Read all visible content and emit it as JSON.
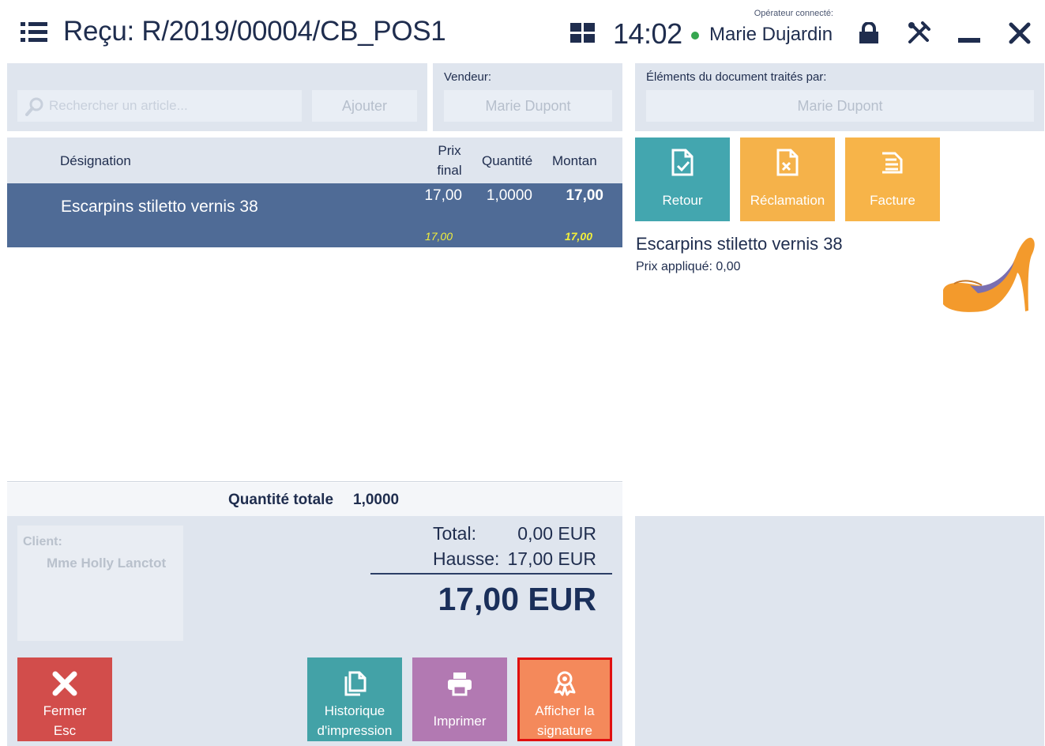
{
  "header": {
    "title": "Reçu: R/2019/00004/CB_POS1",
    "time": "14:02",
    "operator_caption": "Opérateur connecté:",
    "operator_name": "Marie Dujardin"
  },
  "search": {
    "placeholder": "Rechercher un article...",
    "add_label": "Ajouter"
  },
  "vendor": {
    "label": "Vendeur:",
    "value": "Marie Dupont"
  },
  "handled_by": {
    "label": "Éléments du document traités par:",
    "value": "Marie Dupont"
  },
  "table": {
    "columns": {
      "designation": "Désignation",
      "price_line1": "Prix",
      "price_line2": "final",
      "quantity": "Quantité",
      "amount": "Montan"
    },
    "rows": [
      {
        "name": "Escarpins stiletto vernis 38",
        "price": "17,00",
        "quantity": "1,0000",
        "amount": "17,00",
        "sub_price": "17,00",
        "sub_amount": "17,00"
      }
    ],
    "total_qty_label": "Quantité totale",
    "total_qty_value": "1,0000"
  },
  "actions": {
    "retour": "Retour",
    "reclamation": "Réclamation",
    "facture": "Facture"
  },
  "product": {
    "name": "Escarpins stiletto vernis 38",
    "price_applied": "Prix appliqué: 0,00"
  },
  "client": {
    "label": "Client:",
    "name": "Mme Holly Lanctot"
  },
  "totals": {
    "total_label": "Total:",
    "total_value": "0,00 EUR",
    "hausse_label": "Hausse:",
    "hausse_value": "17,00 EUR",
    "grand_total": "17,00 EUR"
  },
  "buttons": {
    "close_line1": "Fermer",
    "close_line2": "Esc",
    "history_line1": "Historique",
    "history_line2": "d'impression",
    "print": "Imprimer",
    "signature_line1": "Afficher la",
    "signature_line2": "signature"
  },
  "colors": {
    "navy": "#1f2d4e",
    "selected_row": "#4f6b96",
    "panel_grey": "#dfe5ee",
    "teal": "#43a6af",
    "orange": "#f5b24a",
    "red": "#d24d4b",
    "purple": "#b279b2",
    "coral": "#f4895b",
    "highlight": "#f2ef3a"
  },
  "icons": {
    "menu": "hamburger-list-icon",
    "tiles": "grid-tiles-icon",
    "lock": "lock-icon",
    "tools": "tools-icon",
    "minimize": "minimize-icon",
    "close": "close-icon",
    "search": "search-icon",
    "retour": "document-check-icon",
    "reclamation": "document-x-icon",
    "facture": "document-lines-icon",
    "history": "documents-copy-icon",
    "print": "printer-icon",
    "signature": "award-ribbon-icon"
  }
}
